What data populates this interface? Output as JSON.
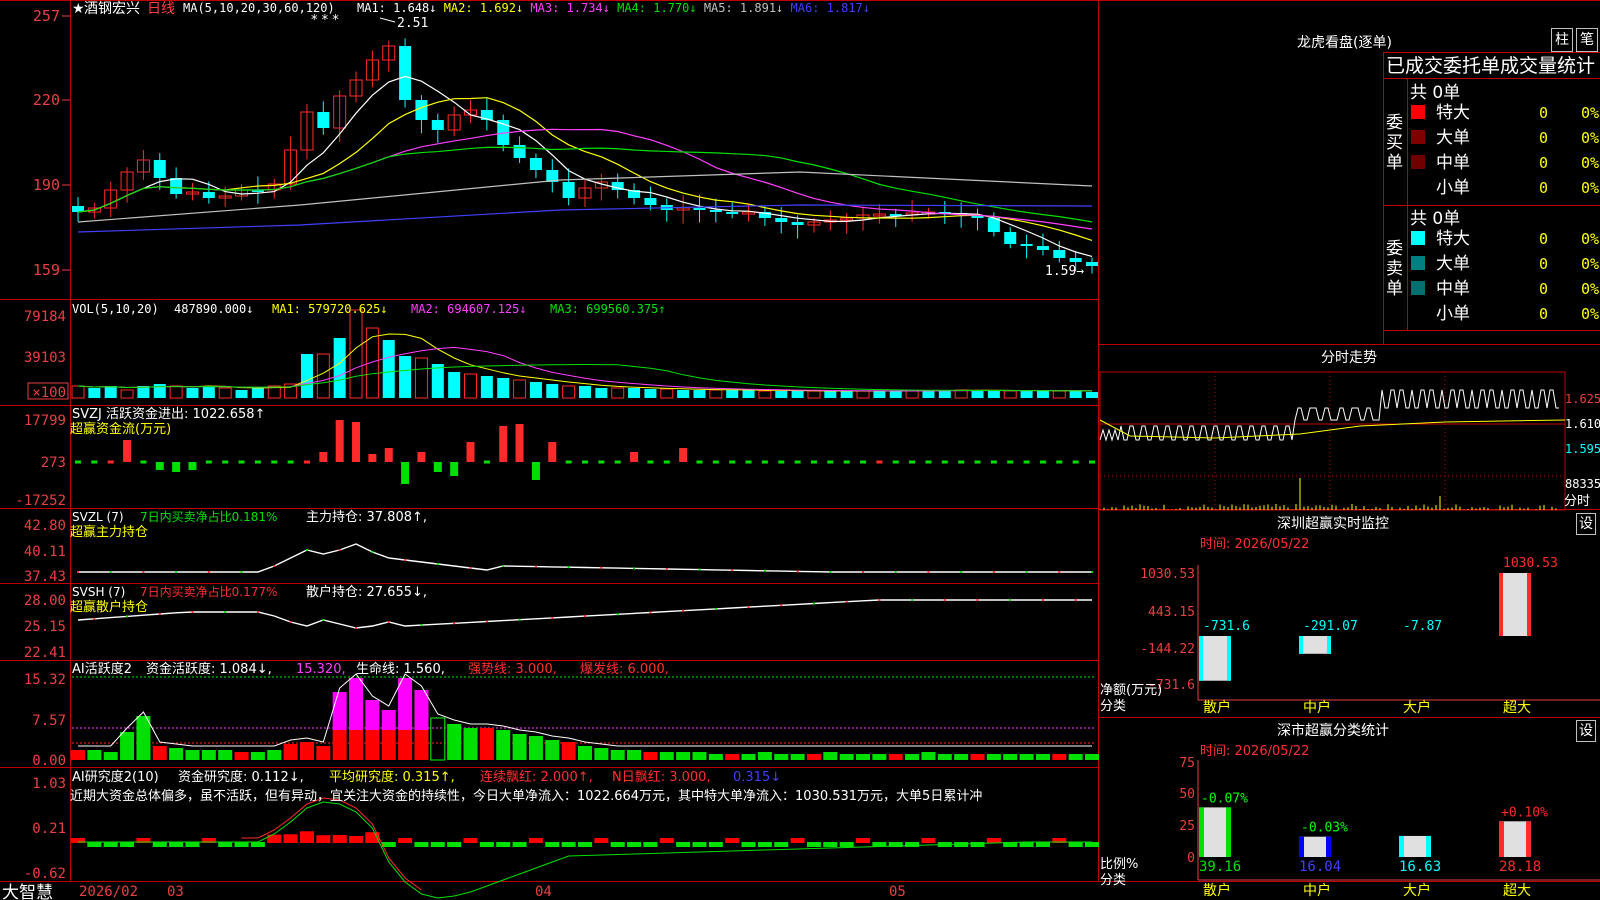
{
  "kline": {
    "stock_name": "酒钢宏兴",
    "star": "★",
    "period": "日线",
    "ma_label": "MA(5,10,20,30,60,120)",
    "ma_values": [
      {
        "text": "MA1: 1.648↓",
        "color": "#ffffff"
      },
      {
        "text": "MA2: 1.692↓",
        "color": "#ffff00"
      },
      {
        "text": "MA3: 1.734↓",
        "color": "#ff40ff"
      },
      {
        "text": "MA4: 1.770↓",
        "color": "#00e000"
      },
      {
        "text": "MA5: 1.891↓",
        "color": "#c0c0c0"
      },
      {
        "text": "MA6: 1.817↓",
        "color": "#4040ff"
      }
    ],
    "y_labels": [
      "257",
      "220",
      "190",
      "159"
    ],
    "high_mark": "2.51",
    "low_mark": "1.59→",
    "stars": "* *   *"
  },
  "vol": {
    "label": "VOL(5,10,20)",
    "value": "487890.000↓",
    "ma1": "MA1: 579720.625↓",
    "ma2": "MA2: 694607.125↓",
    "ma3": "MA3: 699560.375↑",
    "y_labels": [
      "79184",
      "39103",
      "×100"
    ]
  },
  "svzj": {
    "label": "SVZJ  活跃资金进出: 1022.658↑",
    "sub": "超赢资金流(万元)",
    "y_labels": [
      "17799",
      "273",
      "-17252"
    ]
  },
  "svzl": {
    "label": "SVZL (7)",
    "ratio": "7日内买卖净占比0.181%",
    "hold": "主力持仓: 37.808↑,",
    "sub": "超赢主力持仓",
    "y_labels": [
      "42.80",
      "40.11",
      "37.43"
    ]
  },
  "svsh": {
    "label": "SVSH (7)",
    "ratio": "7日内买卖净占比0.177%",
    "hold": "散户持仓: 27.655↓,",
    "sub": "超赢散户持仓",
    "y_labels": [
      "28.00",
      "25.15",
      "22.41"
    ]
  },
  "ai_active": {
    "label": "AI活跃度2",
    "v1": "资金活跃度: 1.084↓,",
    "v2": "15.320,",
    "v3": "生命线: 1.560,",
    "v4": "强势线: 3.000,",
    "v5": "爆发线: 6.000,",
    "y_labels": [
      "15.32",
      "7.57",
      "0.00"
    ]
  },
  "ai_research": {
    "label": "AI研究度2(10)",
    "v1": "资金研究度: 0.112↓,",
    "v2": "平均研究度: 0.315↑,",
    "v3": "连续飘红: 2.000↑,",
    "v4": "N日飘红: 3.000,",
    "v5": "0.315↓",
    "comment": "近期大资金总体偏多，虽不活跃，但有异动，宜关注大资金的持续性，今日大单净流入：1022.664万元，其中特大单净流入：1030.531万元，大单5日累计冲",
    "y_labels": [
      "1.03",
      "0.21",
      "-0.62"
    ]
  },
  "xaxis": {
    "brand": "大智慧",
    "labels": [
      "2026/02",
      "03",
      "04",
      "05"
    ]
  },
  "longhu": {
    "title": "龙虎看盘(逐单)",
    "btn1": "柱",
    "btn2": "笔",
    "header": "已成交委托单成交量统计",
    "buy_label": "委买单",
    "sell_label": "委卖单",
    "buy_total": "共 0单",
    "sell_total": "共 0单",
    "buy_rows": [
      {
        "name": "特大",
        "count": "0",
        "pct": "0%",
        "color": "#ff0000"
      },
      {
        "name": "大单",
        "count": "0",
        "pct": "0%",
        "color": "#800000"
      },
      {
        "name": "中单",
        "count": "0",
        "pct": "0%",
        "color": "#700000"
      },
      {
        "name": "小单",
        "count": "0",
        "pct": "0%",
        "color": "#000000"
      }
    ],
    "sell_rows": [
      {
        "name": "特大",
        "count": "0",
        "pct": "0%",
        "color": "#00ffff"
      },
      {
        "name": "大单",
        "count": "0",
        "pct": "0%",
        "color": "#008080"
      },
      {
        "name": "中单",
        "count": "0",
        "pct": "0%",
        "color": "#007070"
      },
      {
        "name": "小单",
        "count": "0",
        "pct": "0%",
        "color": "#000000"
      }
    ]
  },
  "fenshi": {
    "title": "分时走势",
    "y_labels": [
      "1.625",
      "1.610",
      "1.595"
    ],
    "vol_label": "88335",
    "btn": "分时"
  },
  "sz_monitor": {
    "title": "深圳超赢实时监控",
    "btn": "设",
    "time": "时间: 2026/05/22",
    "y_labels": [
      "1030.53",
      "443.15",
      "-144.22",
      "-731.6"
    ],
    "y_axis_name": "净额(万元)",
    "x_axis_name": "分类",
    "bars": [
      {
        "cat": "散户",
        "value": "-731.6"
      },
      {
        "cat": "中户",
        "value": "-291.07"
      },
      {
        "cat": "大户",
        "value": "-7.87"
      },
      {
        "cat": "超大",
        "value": "1030.53"
      }
    ]
  },
  "sz_class": {
    "title": "深市超赢分类统计",
    "btn": "设",
    "time": "时间: 2026/05/22",
    "y_labels": [
      "75",
      "50",
      "25",
      "0"
    ],
    "y_axis_name": "比例%",
    "x_axis_name": "分类",
    "bars": [
      {
        "cat": "散户",
        "pct": "39.16",
        "delta": "-0.07%"
      },
      {
        "cat": "中户",
        "pct": "16.04",
        "delta": "-0.03%"
      },
      {
        "cat": "大户",
        "pct": "16.63",
        "delta": ""
      },
      {
        "cat": "超大",
        "pct": "28.18",
        "delta": "+0.10%"
      }
    ]
  }
}
